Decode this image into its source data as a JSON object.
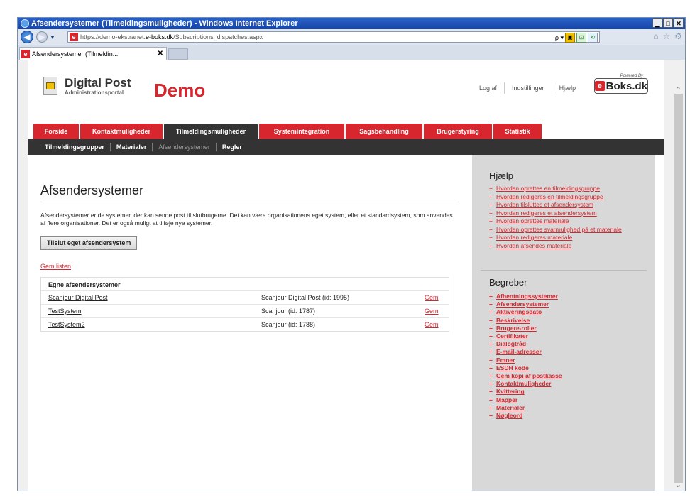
{
  "window": {
    "title": "Afsendersystemer (Tilmeldingsmuligheder) - Windows Internet Explorer"
  },
  "address": {
    "url_prefix": "https://demo-ekstranet.",
    "url_domain": "e-boks.dk",
    "url_path": "/Subscriptions_dispatches.aspx",
    "search_glyph": "ρ ▾"
  },
  "tab": {
    "label": "Afsendersystemer (Tilmeldin...",
    "close": "✕"
  },
  "site": {
    "logo_title": "Digital Post",
    "logo_subtitle": "Administrationsportal",
    "demo": "Demo"
  },
  "toplinks": [
    "Log af",
    "Indstillinger",
    "Hjælp"
  ],
  "powered": {
    "label": "Powered By",
    "e": "e",
    "brand": "Boks.dk"
  },
  "mainnav": [
    "Forside",
    "Kontaktmuligheder",
    "Tilmeldingsmuligheder",
    "Systemintegration",
    "Sagsbehandling",
    "Brugerstyring",
    "Statistik"
  ],
  "subnav": [
    "Tilmeldingsgrupper",
    "Materialer",
    "Afsendersystemer",
    "Regler"
  ],
  "page": {
    "title": "Afsendersystemer",
    "description": "Afsendersystemer er de systemer, der kan sende post til slutbrugerne. Det kan være organisationens eget system, eller et standardsystem, som anvendes af flere organisationer. Det er også muligt at tilføje nye systemer.",
    "connect_button": "Tilslut eget afsendersystem",
    "save_list": "Gem listen"
  },
  "table": {
    "header": "Egne afsendersystemer",
    "rows": [
      {
        "name": "Scanjour Digital Post",
        "info": "Scanjour Digital Post (id: 1995)",
        "action": "Gem"
      },
      {
        "name": "TestSystem",
        "info": "Scanjour (id: 1787)",
        "action": "Gem"
      },
      {
        "name": "TestSystem2",
        "info": "Scanjour (id: 1788)",
        "action": "Gem"
      }
    ]
  },
  "help": {
    "title": "Hjælp",
    "links": [
      "Hvordan oprettes en tilmeldingsgruppe",
      "Hvordan redigeres en tilmeldingsgruppe",
      "Hvordan tilsluttes et afsendersystem",
      "Hvordan redigeres et afsendersystem",
      "Hvordan oprettes materiale",
      "Hvordan oprettes svarmulighed på et materiale",
      "Hvordan redigeres materiale",
      "Hvordan afsendes materiale"
    ]
  },
  "terms": {
    "title": "Begreber",
    "links": [
      "Afhentningssystemer",
      "Afsendersystemer",
      "Aktiveringsdato",
      "Beskrivelse",
      "Brugere-roller",
      "Certifikater",
      "Dialogtråd",
      "E-mail-adresser",
      "Emner",
      "ESDH kode",
      "Gem kopi af postkasse",
      "Kontaktmuligheder",
      "Kvittering",
      "Mapper",
      "Materialer",
      "Nøgleord"
    ]
  }
}
